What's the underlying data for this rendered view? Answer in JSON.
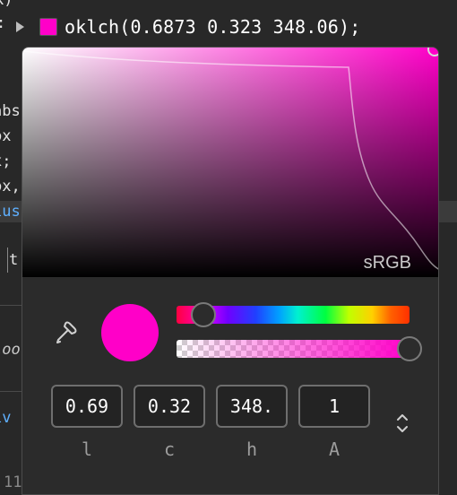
{
  "editor": {
    "top_fragment": "k)",
    "line_fragments": [
      "abs",
      "px",
      "x;",
      "px,",
      "ius",
      ";",
      "t"
    ],
    "lower_fragment": "loo",
    "div_fragment": "iv",
    "bottom_fragment": "11",
    "declaration": {
      "value": "oklch(0.6873 0.323 348.06);",
      "swatch_color": "#ff00c8"
    }
  },
  "picker": {
    "gamut_label": "sRGB",
    "current_color": "#ff00c8",
    "hue": 348.06,
    "alpha": 1,
    "inputs": [
      {
        "value": "0.69",
        "label": "l"
      },
      {
        "value": "0.32",
        "label": "c"
      },
      {
        "value": "348.",
        "label": "h"
      },
      {
        "value": "1",
        "label": "A"
      }
    ],
    "icons": {
      "eyedropper": "eyedropper-icon",
      "format_toggle": "chevron-up-down-icon"
    }
  }
}
